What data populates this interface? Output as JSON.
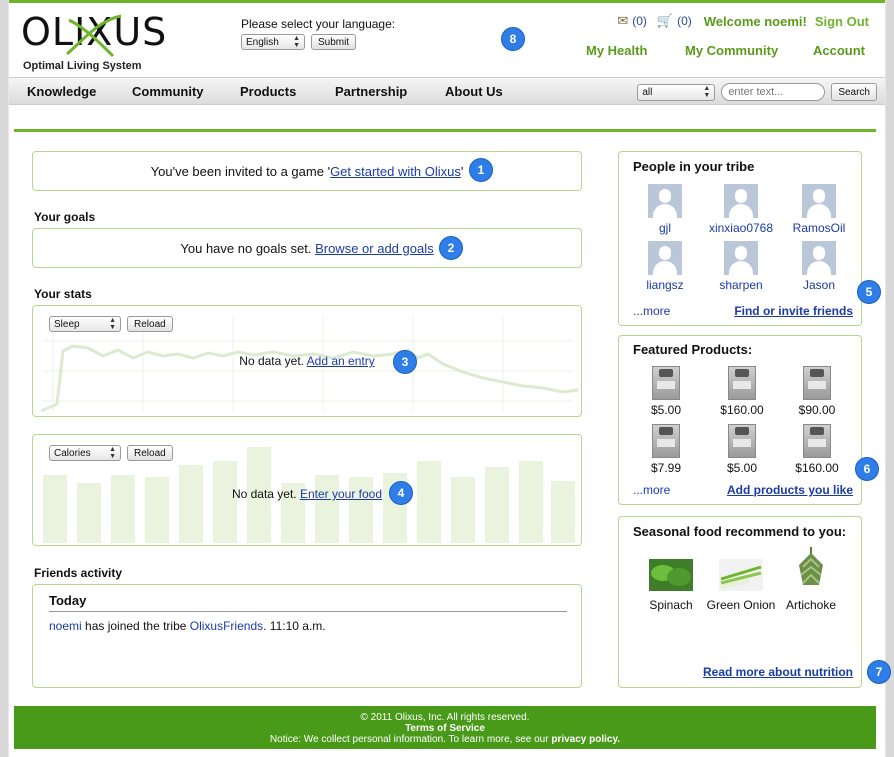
{
  "header": {
    "logo_text": "OLIXUS",
    "logo_tagline": "Optimal Living System",
    "language_prompt": "Please select your language:",
    "language_value": "English",
    "submit_label": "Submit",
    "messages_count": "(0)",
    "cart_count": "(0)",
    "welcome": "Welcome noemi!",
    "sign_out": "Sign Out",
    "nav_links": [
      "My Health",
      "My Community",
      "Account"
    ]
  },
  "main_nav": {
    "items": [
      "Knowledge",
      "Community",
      "Products",
      "Partnership",
      "About Us"
    ],
    "search_scope": "all",
    "search_placeholder": "enter text...",
    "search_button": "Search"
  },
  "invite": {
    "text": "You've been invited to a game '",
    "link": "Get started with Olixus",
    "suffix": "'"
  },
  "goals": {
    "heading": "Your goals",
    "text": "You have no goals set. ",
    "link": "Browse or add goals"
  },
  "stats": {
    "heading": "Your stats",
    "chart1": {
      "select": "Sleep",
      "reload": "Reload",
      "text": "No data yet. ",
      "link": "Add an entry"
    },
    "chart2": {
      "select": "Calories",
      "reload": "Reload",
      "text": "No data yet. ",
      "link": "Enter your food"
    }
  },
  "friends_activity": {
    "heading": "Friends activity",
    "day": "Today",
    "user": "noemi",
    "action": " has joined the tribe ",
    "tribe": "OlixusFriends",
    "time": ". 11:10 a.m."
  },
  "tribe": {
    "title": "People in your tribe",
    "people": [
      "gjl",
      "xinxiao0768",
      "RamosOil",
      "liangsz",
      "sharpen",
      "Jason"
    ],
    "more": "...more",
    "invite_link": "Find or invite friends"
  },
  "featured": {
    "title": "Featured Products:",
    "prices": [
      "$5.00",
      "$160.00",
      "$90.00",
      "$7.99",
      "$5.00",
      "$160.00"
    ],
    "more": "...more",
    "add_link": "Add products you like"
  },
  "seasonal": {
    "title": "Seasonal food recommend to you:",
    "foods": [
      "Spinach",
      "Green Onion",
      "Artichoke"
    ],
    "read_more": "Read more about nutrition"
  },
  "badges": [
    "1",
    "2",
    "3",
    "4",
    "5",
    "6",
    "7",
    "8"
  ],
  "footer": {
    "copyright": "© 2011 Olixus, Inc. All rights reserved.",
    "terms": "Terms of Service",
    "notice": "Notice: We collect personal information. To learn more, see our ",
    "privacy": "privacy policy."
  },
  "colors": {
    "brand_green": "#6fb52c",
    "badge_blue": "#2f7ee8",
    "link_blue": "#1a3ba8"
  }
}
